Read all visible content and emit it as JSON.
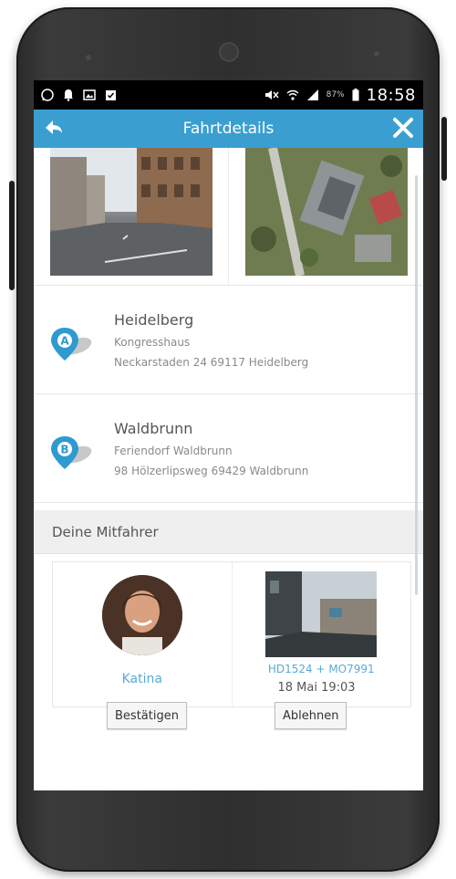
{
  "status_bar": {
    "battery_percent": "87%",
    "time": "18:58"
  },
  "header": {
    "title": "Fahrtdetails",
    "back_icon": "back-arrow-icon",
    "close_icon": "close-icon",
    "accent_color": "#3a9fd0"
  },
  "route": {
    "start": {
      "badge": "A",
      "city": "Heidelberg",
      "place": "Kongresshaus",
      "street": "Neckarstaden 24 69117 Heidelberg"
    },
    "destination": {
      "badge": "B",
      "city": "Waldbrunn",
      "place": "Feriendorf Waldbrunn",
      "street": "98 Hölzerlipsweg 69429 Waldbrunn"
    }
  },
  "passengers_section": {
    "title": "Deine Mitfahrer",
    "passenger": {
      "name": "Katina"
    },
    "vehicle": {
      "plate": "HD1524 + MO7991",
      "datetime": "18 Mai 19:03"
    },
    "confirm_label": "Bestätigen",
    "reject_label": "Ablehnen"
  }
}
